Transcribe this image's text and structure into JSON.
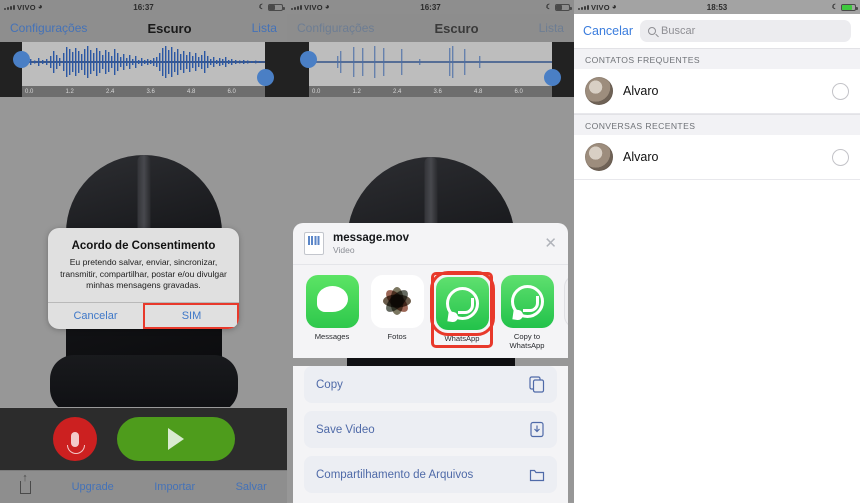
{
  "panels": {
    "recorder": {
      "statusbar": {
        "carrier": "VIVO",
        "wifi_icon": "wifi-icon",
        "time": "16:37",
        "moon_icon": "moon-icon",
        "battery_icon": "battery-icon"
      },
      "nav": {
        "back": "Configurações",
        "title": "Escuro",
        "right": "Lista"
      },
      "waveform": {
        "ticks": [
          "0.0",
          "1.2",
          "2.4",
          "3.6",
          "4.8",
          "6.0"
        ],
        "left_handle_icon": "trim-handle-left-icon",
        "right_handle_icon": "trim-handle-right-icon"
      },
      "alert": {
        "title": "Acordo de Consentimento",
        "message": "Eu pretendo salvar, enviar, sincronizar, transmitir, compartilhar, postar e/ou divulgar minhas mensagens gravadas.",
        "cancel": "Cancelar",
        "confirm": "SIM",
        "highlight_color": "#e8392b"
      },
      "transport": {
        "record_icon": "microphone-icon",
        "record_color": "#cc2020",
        "play_icon": "play-icon",
        "play_color": "#4e9c1c"
      },
      "tabbar": {
        "share_icon": "share-icon",
        "items": [
          "Upgrade",
          "Importar",
          "Salvar"
        ]
      }
    },
    "sharesheet": {
      "statusbar": {
        "carrier": "VIVO",
        "wifi_icon": "wifi-icon",
        "time": "16:37",
        "moon_icon": "moon-icon",
        "battery_icon": "battery-icon"
      },
      "nav": {
        "back": "Configurações",
        "title": "Escuro",
        "right": "Lista"
      },
      "header": {
        "file_icon": "video-file-icon",
        "filename": "message.mov",
        "filetype": "Video",
        "close_icon": "close-icon"
      },
      "apps": [
        {
          "label": "Messages",
          "icon": "messages-app-icon",
          "selected": false
        },
        {
          "label": "Fotos",
          "icon": "photos-app-icon",
          "selected": false
        },
        {
          "label": "WhatsApp",
          "icon": "whatsapp-app-icon",
          "selected": true
        },
        {
          "label": "Copy to WhatsApp",
          "icon": "whatsapp-app-icon",
          "selected": false
        }
      ],
      "actions": [
        {
          "label": "Copy",
          "icon": "copy-icon"
        },
        {
          "label": "Save Video",
          "icon": "save-video-icon"
        },
        {
          "label": "Compartilhamento de Arquivos",
          "icon": "folder-icon"
        }
      ],
      "highlight_color": "#e8392b"
    },
    "contacts": {
      "statusbar": {
        "carrier": "VIVO",
        "wifi_icon": "wifi-icon",
        "time": "18:53",
        "moon_icon": "moon-icon",
        "battery_icon": "battery-charging-icon"
      },
      "cancel": "Cancelar",
      "search_placeholder": "Buscar",
      "search_icon": "search-icon",
      "sections": [
        {
          "title": "CONTATOS FREQUENTES",
          "rows": [
            {
              "name": "Alvaro",
              "avatar": "contact-avatar",
              "select_icon": "radio-unchecked-icon"
            }
          ]
        },
        {
          "title": "CONVERSAS RECENTES",
          "rows": [
            {
              "name": "Alvaro",
              "avatar": "contact-avatar",
              "select_icon": "radio-unchecked-icon"
            }
          ]
        }
      ]
    }
  }
}
